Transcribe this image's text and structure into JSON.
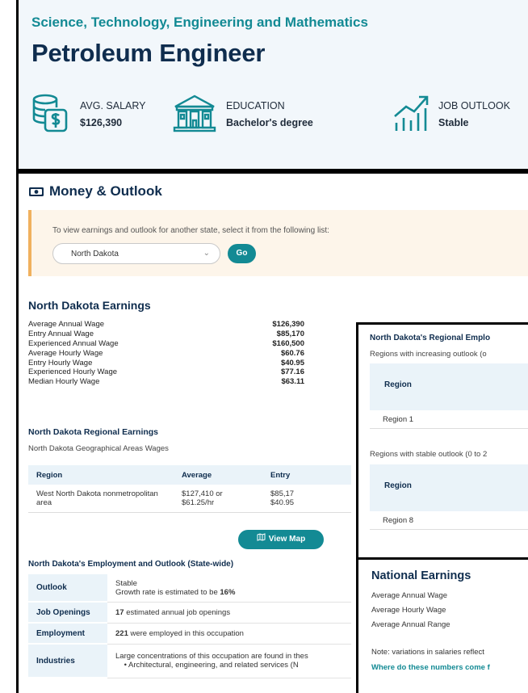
{
  "header": {
    "category": "Science, Technology, Engineering and Mathematics",
    "title": "Petroleum Engineer",
    "stats": [
      {
        "icon": "salary-money-icon",
        "label": "AVG. SALARY",
        "value": "$126,390"
      },
      {
        "icon": "education-building-icon",
        "label": "EDUCATION",
        "value": "Bachelor's degree"
      },
      {
        "icon": "job-outlook-chart-icon",
        "label": "JOB OUTLOOK",
        "value": "Stable"
      }
    ]
  },
  "money": {
    "title": "Money & Outlook",
    "icon": "money-bill-icon",
    "state_prompt": "To view earnings and outlook for another state, select it from the following list:",
    "state_selected": "North Dakota",
    "go_label": "Go"
  },
  "earnings": {
    "title": "North Dakota Earnings",
    "rows": [
      {
        "label": "Average Annual Wage",
        "value": "$126,390"
      },
      {
        "label": "Entry Annual Wage",
        "value": "$85,170"
      },
      {
        "label": "Experienced Annual Wage",
        "value": "$160,500"
      },
      {
        "label": "Average Hourly Wage",
        "value": "$60.76"
      },
      {
        "label": "Entry Hourly Wage",
        "value": "$40.95"
      },
      {
        "label": "Experienced Hourly Wage",
        "value": "$77.16"
      },
      {
        "label": "Median Hourly Wage",
        "value": "$63.11"
      }
    ]
  },
  "regional": {
    "title": "North Dakota Regional Earnings",
    "subtitle": "North Dakota Geographical Areas Wages",
    "headers": [
      "Region",
      "Average",
      "Entry"
    ],
    "row": {
      "region_line1": "West North Dakota nonmetropolitan",
      "region_line2": "area",
      "avg_line1": "$127,410 or",
      "avg_line2": "$61.25/hr",
      "entry_line1": "$85,17",
      "entry_line2": "$40.95"
    },
    "map_button": "View Map",
    "map_icon": "map-icon"
  },
  "employment": {
    "title": "North Dakota's Employment and Outlook (State-wide)",
    "outlook_label": "Outlook",
    "outlook_line1": "Stable",
    "outlook_line2_prefix": "Growth rate is estimated to be ",
    "outlook_rate": "16%",
    "openings_label": "Job Openings",
    "openings_count": "17",
    "openings_text": " estimated annual job openings",
    "employment_label": "Employment",
    "employment_count": "221",
    "employment_text": " were employed in this occupation",
    "industries_label": "Industries",
    "industries_line1": "Large concentrations of this occupation are found in thes",
    "industries_line2": "• Architectural, engineering, and related services (N"
  },
  "regional_outlook": {
    "title": "North Dakota's Regional Emplo",
    "increasing": "Regions with increasing outlook (o",
    "stable": "Regions with stable outlook (0 to 2",
    "region_header": "Region",
    "region_increasing": "Region 1",
    "region_stable": "Region 8"
  },
  "national": {
    "title": "National Earnings",
    "rows": [
      "Average Annual Wage",
      "Average Hourly Wage",
      "Average Annual Range"
    ],
    "note": "Note: variations in salaries reflect",
    "link": "Where do these numbers come f"
  },
  "colors": {
    "teal": "#138a94",
    "navy": "#0f2d4e",
    "notice_bg": "#fdf5ea",
    "notice_border": "#f0b15e"
  }
}
